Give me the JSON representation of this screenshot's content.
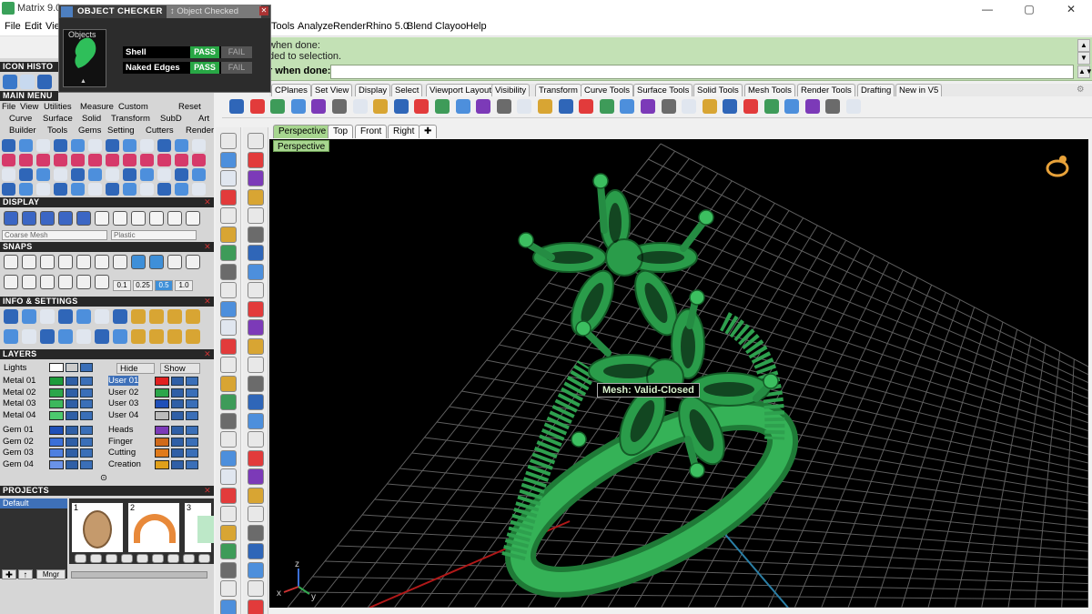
{
  "window": {
    "title": "Matrix 9.0",
    "minimize": "—",
    "maximize": "▢",
    "close": "✕"
  },
  "menu": {
    "left": [
      "File",
      "Edit",
      "Vie"
    ],
    "right": [
      "Tools",
      "Analyze",
      "Render",
      "Rhino 5.0",
      "Blend",
      "Clayoo",
      "Help"
    ]
  },
  "command": {
    "line1": "when done:",
    "line2": "ded to selection.",
    "prompt_label": "r when done:",
    "prompt_value": ""
  },
  "object_checker": {
    "title": "OBJECT CHECKER",
    "tab2": "Object Checked",
    "objects_label": "Objects",
    "rows": [
      {
        "name": "Shell",
        "pass": "PASS",
        "fail": "FAIL"
      },
      {
        "name": "Naked Edges",
        "pass": "PASS",
        "fail": "FAIL"
      }
    ]
  },
  "left": {
    "icon_history": "ICON HISTO",
    "main_menu": "MAIN MENU",
    "mm_row1": [
      "File",
      "View",
      "Utilities",
      "Measure",
      "Custom",
      "Reset"
    ],
    "mm_row2": [
      "Curve",
      "Surface",
      "Solid",
      "Transform",
      "SubD",
      "Art"
    ],
    "mm_row3": [
      "Builder",
      "Tools",
      "Gems",
      "Setting",
      "Cutters",
      "Render"
    ],
    "display": "DISPLAY",
    "display_mesh": "Coarse Mesh",
    "display_mat": "Plastic",
    "snaps": "SNAPS",
    "snap_vals": [
      "0.1",
      "0.25",
      "0.5",
      "1.0"
    ],
    "info": "INFO & SETTINGS",
    "layers": "LAYERS",
    "lights": "Lights",
    "hide": "Hide",
    "show": "Show",
    "layers_left": [
      "Metal 01",
      "Metal 02",
      "Metal 03",
      "Metal 04",
      "Gem 01",
      "Gem 02",
      "Gem 03",
      "Gem 04"
    ],
    "layers_right": [
      "User 01",
      "User 02",
      "User 03",
      "User 04",
      "Heads",
      "Finger",
      "Cutting",
      "Creation"
    ],
    "projects": "PROJECTS",
    "project_default": "Default",
    "proj_nums": [
      "1",
      "2",
      "3"
    ],
    "mngr": "Mngr"
  },
  "tabs": [
    "CPlanes",
    "Set View",
    "Display",
    "Select",
    "Viewport Layout",
    "Visibility",
    "Transform",
    "Curve Tools",
    "Surface Tools",
    "Solid Tools",
    "Mesh Tools",
    "Render Tools",
    "Drafting",
    "New in V5"
  ],
  "viewport": {
    "tabs": [
      "Perspective",
      "Top",
      "Front",
      "Right"
    ],
    "add_tab": "✚",
    "label": "Perspective",
    "tooltip": "Mesh: Valid-Closed",
    "axis_z": "z",
    "axis_x": "x",
    "axis_y": "y"
  },
  "colors": {
    "ring_green": "#2b9d49",
    "viewport_bg": "#000000",
    "command_bg": "#c3e1b5",
    "grid": "#6f6f6f"
  }
}
